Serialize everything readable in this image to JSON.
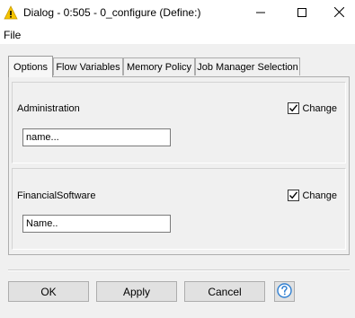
{
  "window": {
    "title": "Dialog - 0:505 - 0_configure (Define:)",
    "icon": "warning-triangle-icon",
    "minimize_icon": "minimize-icon",
    "maximize_icon": "maximize-icon",
    "close_icon": "close-icon"
  },
  "menu": {
    "items": [
      {
        "label": "File"
      }
    ]
  },
  "tabs": [
    {
      "label": "Options",
      "active": true
    },
    {
      "label": "Flow Variables",
      "active": false
    },
    {
      "label": "Memory Policy",
      "active": false
    },
    {
      "label": "Job Manager Selection",
      "active": false
    }
  ],
  "fields": [
    {
      "label": "Administration",
      "value": "name...",
      "change_label": "Change",
      "change_checked": true
    },
    {
      "label": "FinancialSoftware",
      "value": "Name..",
      "change_label": "Change",
      "change_checked": true
    }
  ],
  "buttons": {
    "ok": "OK",
    "apply": "Apply",
    "cancel": "Cancel",
    "help_icon": "help-icon"
  },
  "colors": {
    "title_icon": "#f5c400",
    "help_icon": "#2f7fd1",
    "window_bg": "#f0f0f0"
  }
}
